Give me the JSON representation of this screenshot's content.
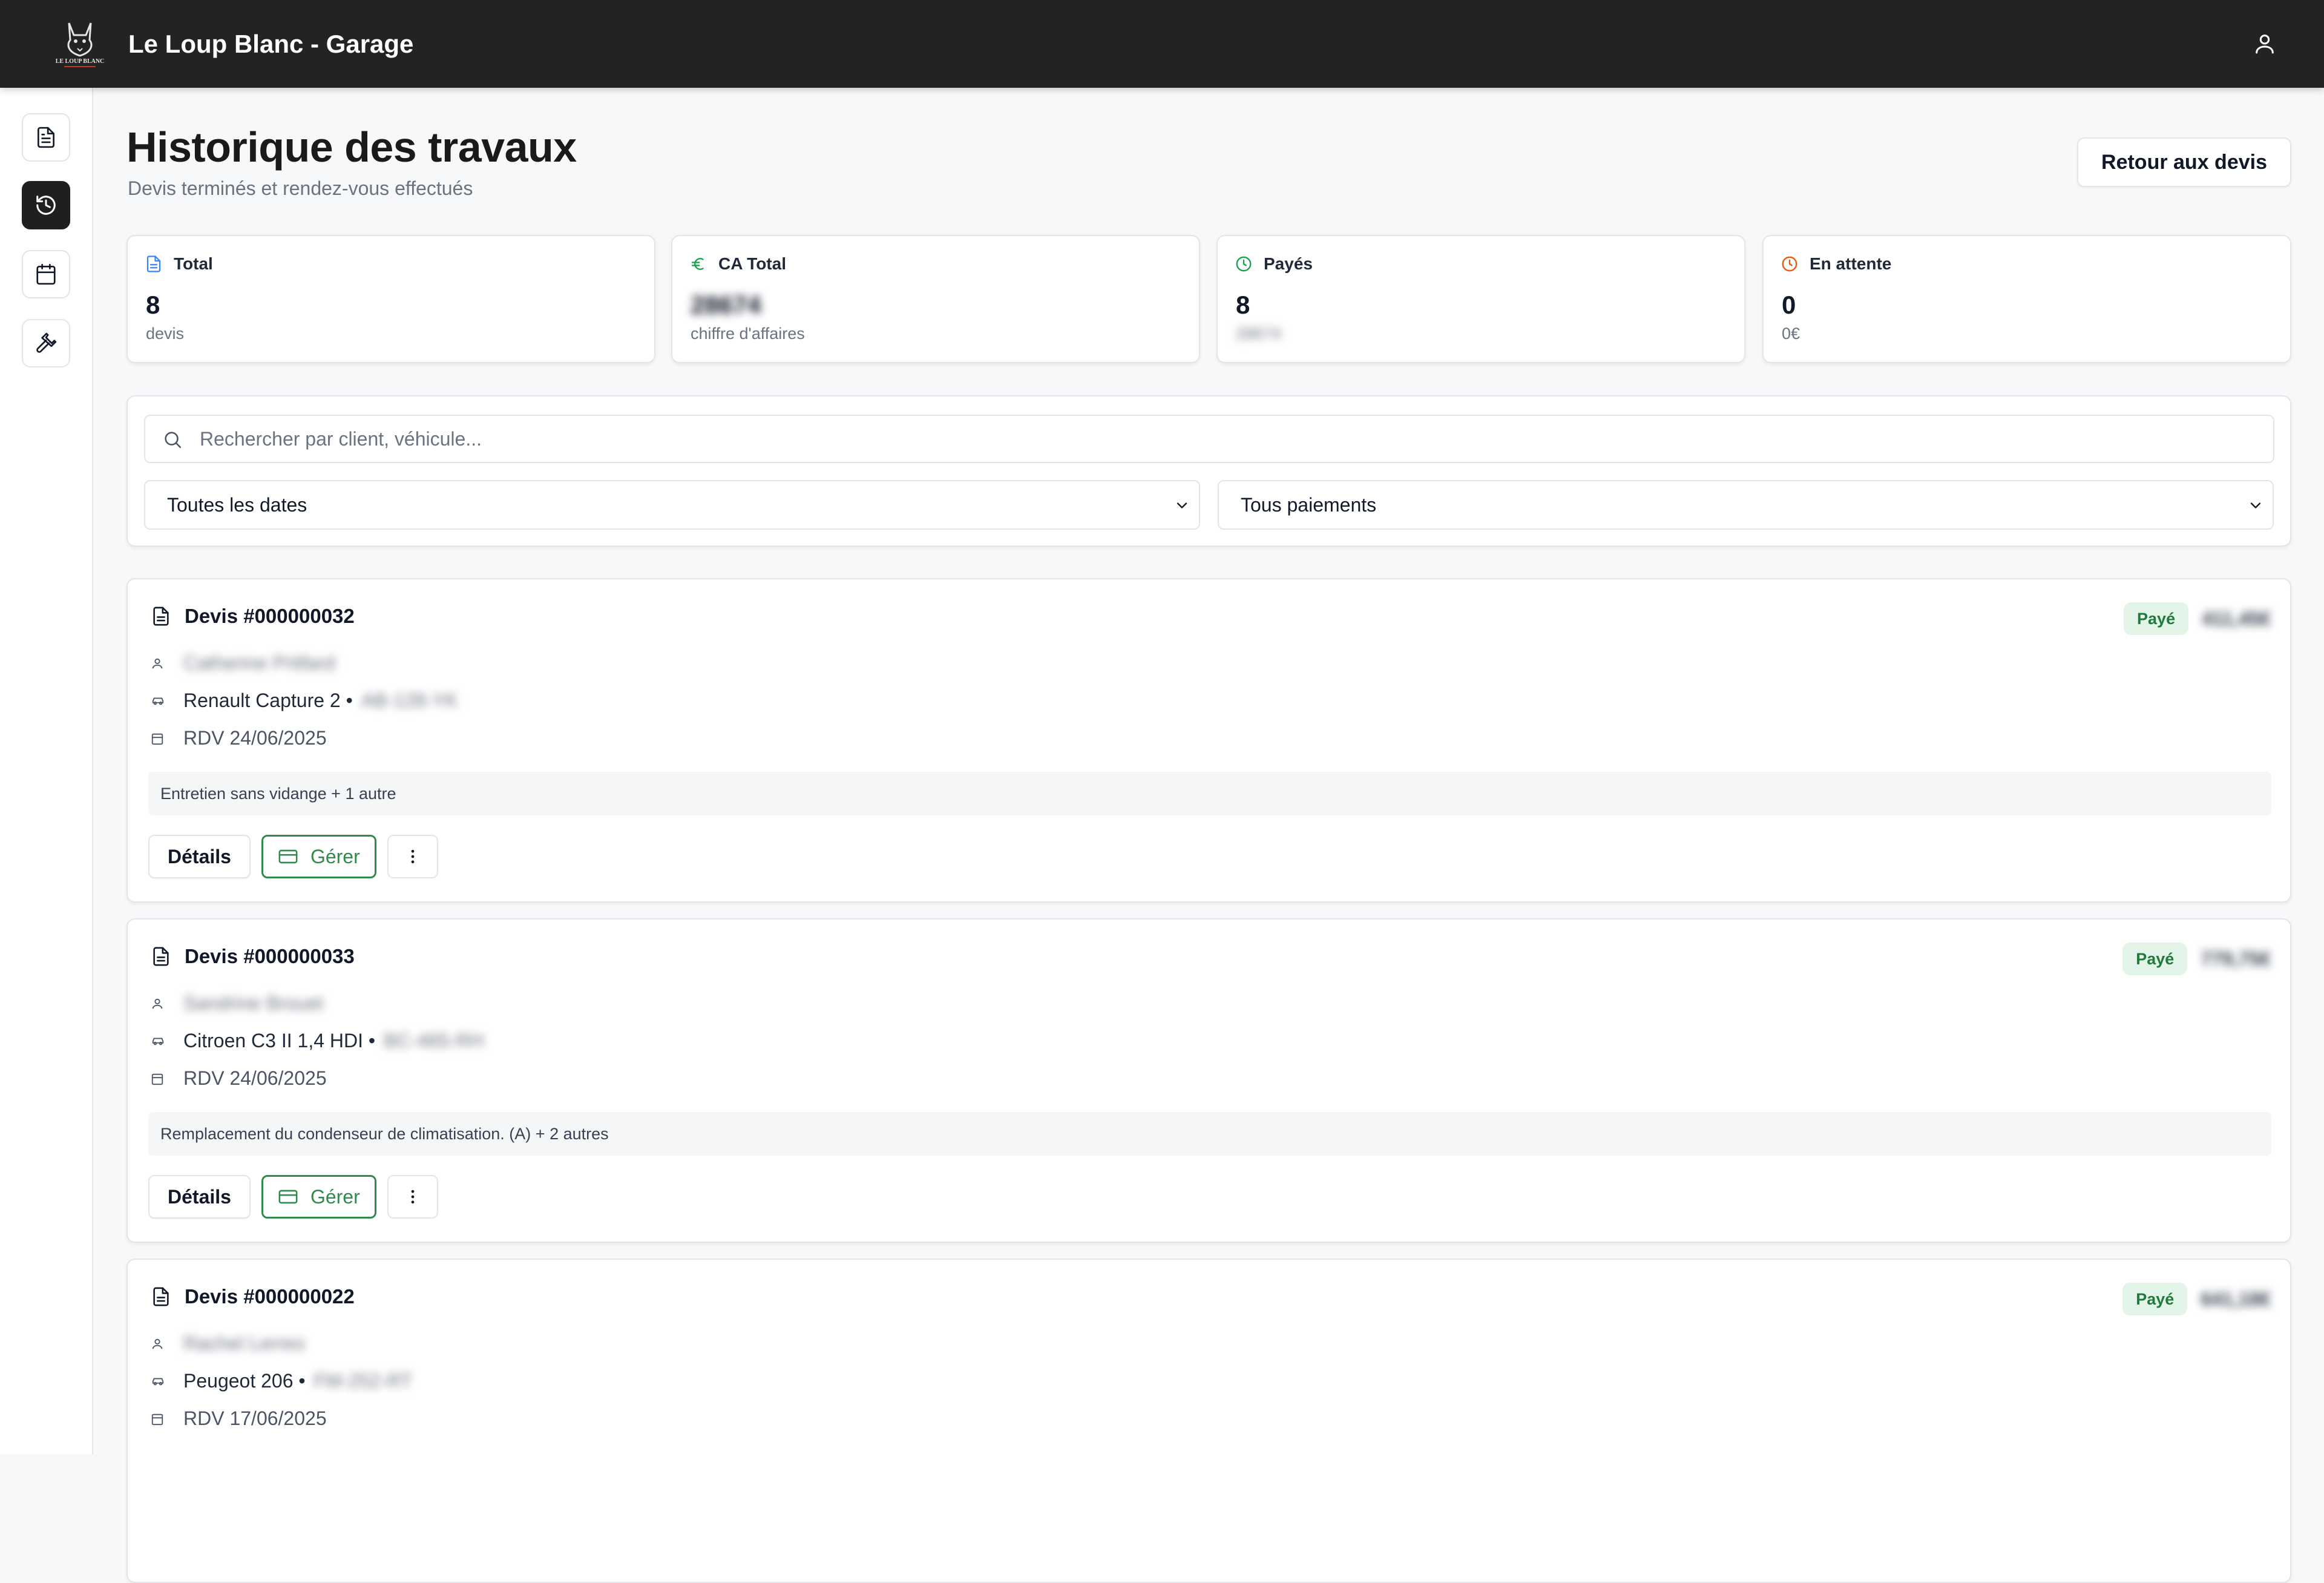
{
  "app": {
    "title": "Le Loup Blanc - Garage",
    "logo_text": "LE LOUP BLANC"
  },
  "sidebar": {
    "items": [
      {
        "name": "devis",
        "icon": "file-text-icon",
        "active": false
      },
      {
        "name": "historique",
        "icon": "history-icon",
        "active": true
      },
      {
        "name": "calendrier",
        "icon": "calendar-icon",
        "active": false
      },
      {
        "name": "outils",
        "icon": "hammer-icon",
        "active": false
      }
    ]
  },
  "page": {
    "title": "Historique des travaux",
    "subtitle": "Devis terminés et rendez-vous effectués",
    "back_button": "Retour aux devis"
  },
  "stats": [
    {
      "label": "Total",
      "icon": "file-text-icon",
      "icon_color": "#3b82f6",
      "value": "8",
      "sub": "devis"
    },
    {
      "label": "CA Total",
      "icon": "euro-icon",
      "icon_color": "#16a34a",
      "value": "28674",
      "sub": "chiffre d'affaires"
    },
    {
      "label": "Payés",
      "icon": "clock-icon",
      "icon_color": "#16a34a",
      "value": "8",
      "sub": "28674"
    },
    {
      "label": "En attente",
      "icon": "clock-icon",
      "icon_color": "#ea580c",
      "value": "0",
      "sub": "0€"
    }
  ],
  "filters": {
    "search_placeholder": "Rechercher par client, véhicule...",
    "search_value": "",
    "date_filter": "Toutes les dates",
    "payment_filter": "Tous paiements"
  },
  "devis": [
    {
      "title": "Devis #000000032",
      "client": "Catherine Pritfard",
      "vehicle": "Renault Capture 2 •",
      "plate": "AB-128-YK",
      "rdv": "RDV 24/06/2025",
      "description": "Entretien sans vidange + 1 autre",
      "status": "Payé",
      "amount": "411,45€"
    },
    {
      "title": "Devis #000000033",
      "client": "Sandrine Brouet",
      "vehicle": "Citroen C3 II 1,4 HDI •",
      "plate": "BC-465-RH",
      "rdv": "RDV 24/06/2025",
      "description": "Remplacement du condenseur de climatisation. (A) + 2 autres",
      "status": "Payé",
      "amount": "779,75€"
    },
    {
      "title": "Devis #000000022",
      "client": "Rachel Lerreo",
      "vehicle": "Peugeot 206 •",
      "plate": "FM-252-RT",
      "rdv": "RDV 17/06/2025",
      "description": "",
      "status": "Payé",
      "amount": "641,18€"
    }
  ],
  "labels": {
    "details": "Détails",
    "manage": "Gérer"
  },
  "colors": {
    "topbar": "#232323",
    "accent_green": "#2f8a4b",
    "badge_bg": "#e3f5e8"
  }
}
